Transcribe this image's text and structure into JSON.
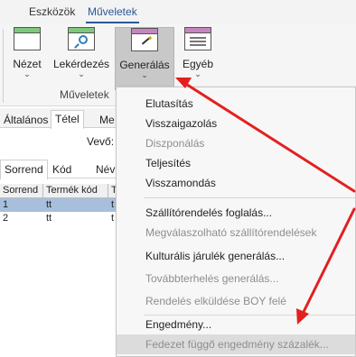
{
  "ribbon_tabs": [
    "Eszközök",
    "Műveletek"
  ],
  "active_tab": "Műveletek",
  "ribbon_buttons": {
    "nezet": "Nézet",
    "lekerdezes": "Lekérdezés",
    "generalas": "Generálás",
    "egyeb": "Egyéb"
  },
  "group_label": "Műveletek",
  "form": {
    "tabs": [
      "Általános",
      "Tétel",
      "Me"
    ],
    "vevo_label": "Vevő:",
    "sub_tabs": [
      "Sorrend",
      "Kód",
      "Név"
    ],
    "grid_headers": [
      "Sorrend",
      "Termék kód",
      "T"
    ],
    "rows": [
      [
        "1",
        "tt",
        "t"
      ],
      [
        "2",
        "tt",
        "t"
      ]
    ]
  },
  "menu": {
    "items": [
      {
        "label": "Elutasítás",
        "disabled": false
      },
      {
        "label": "Visszaigazolás",
        "disabled": false
      },
      {
        "label": "Diszponálás",
        "disabled": true
      },
      {
        "label": "Teljesítés",
        "disabled": false
      },
      {
        "label": "Visszamondás",
        "disabled": false
      },
      {
        "label": "Szállítórendelés foglalás...",
        "disabled": false
      },
      {
        "label": "Megválaszolható szállítórendelések",
        "disabled": true
      },
      {
        "label": "Kulturális járulék generálás...",
        "disabled": false
      },
      {
        "label": "Továbbterhelés generálás...",
        "disabled": true
      },
      {
        "label": "Rendelés elküldése BOY felé",
        "disabled": true
      },
      {
        "label": "Engedmény...",
        "disabled": false
      },
      {
        "label": "Fedezet függő engedmény százalék...",
        "disabled": true
      }
    ]
  },
  "colors": {
    "accent": "#2b579a",
    "arrow": "#e32020",
    "selected_row": "#a7bfdc"
  },
  "icons": [
    "view-window-icon",
    "query-magnifier-icon",
    "generate-wand-icon",
    "other-list-icon",
    "chevron-down-icon"
  ]
}
